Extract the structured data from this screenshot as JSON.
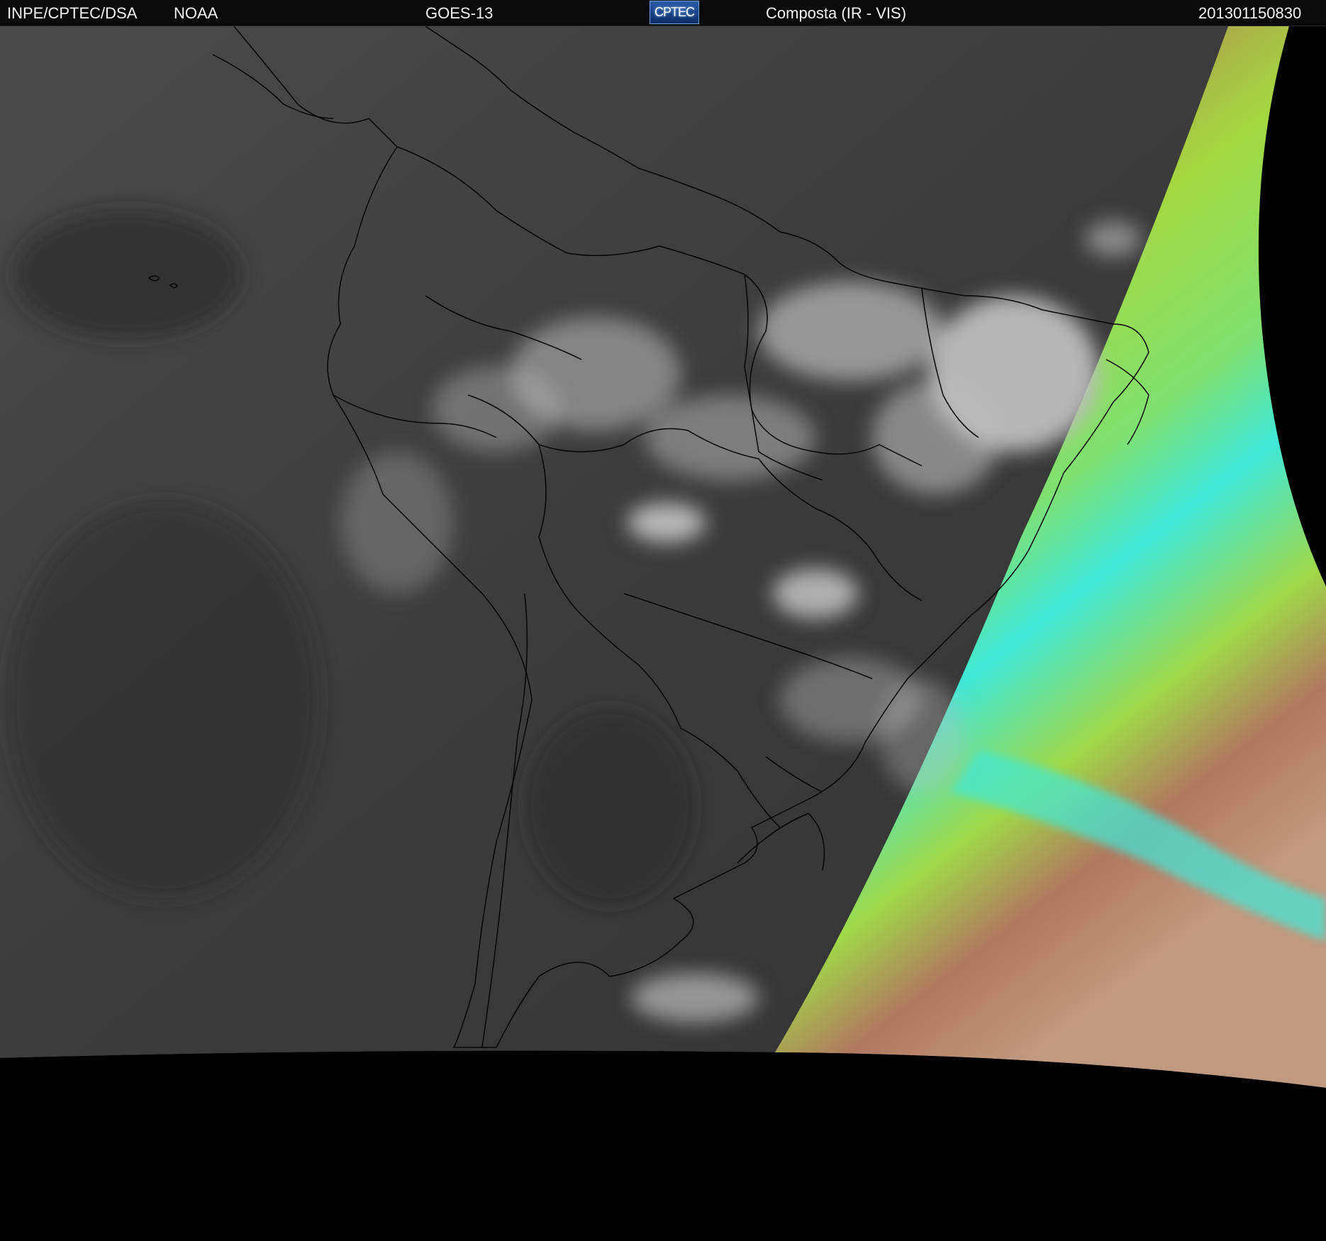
{
  "header": {
    "agency": "INPE/CPTEC/DSA",
    "provider": "NOAA",
    "satellite": "GOES-13",
    "logo_text": "CPTEC",
    "product": "Composta (IR - VIS)",
    "timestamp": "201301150830"
  },
  "map": {
    "region": "South America",
    "background_color": "#000000",
    "ir_cloud_gray": "#3a3a3a",
    "vis_colors": [
      "#b07a5a",
      "#a4e04a",
      "#3fe8d8"
    ],
    "border_color": "#000000"
  }
}
